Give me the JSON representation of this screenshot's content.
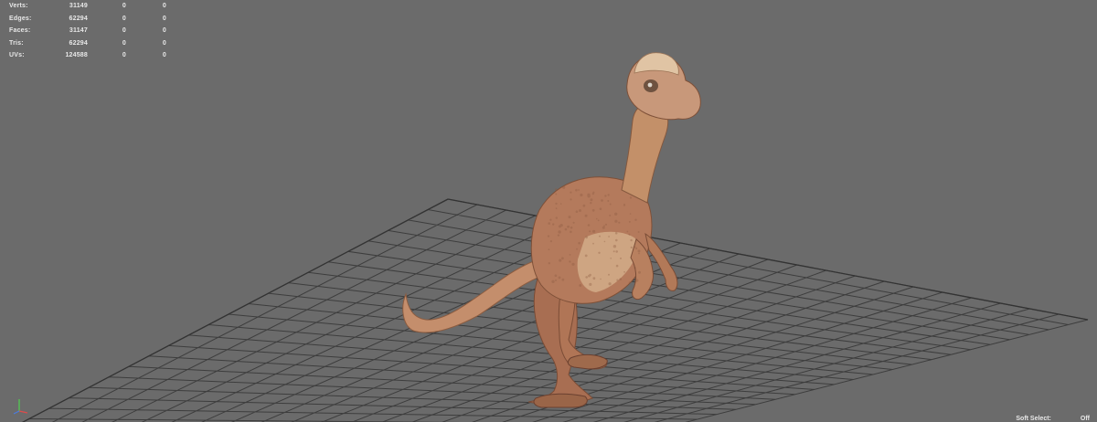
{
  "hud": {
    "rows": [
      {
        "label": "Verts:",
        "v1": "31149",
        "v2": "0",
        "v3": "0"
      },
      {
        "label": "Edges:",
        "v1": "62294",
        "v2": "0",
        "v3": "0"
      },
      {
        "label": "Faces:",
        "v1": "31147",
        "v2": "0",
        "v3": "0"
      },
      {
        "label": "Tris:",
        "v1": "62294",
        "v2": "0",
        "v3": "0"
      },
      {
        "label": "UVs:",
        "v1": "124588",
        "v2": "0",
        "v3": "0"
      }
    ]
  },
  "status": {
    "soft_select_label": "Soft Select:",
    "soft_select_value": "Off"
  },
  "colors": {
    "background": "#6b6b6b",
    "grid": "#3e3e3e",
    "hud_text": "#e8e8e8",
    "model_base": "#b9805a"
  }
}
